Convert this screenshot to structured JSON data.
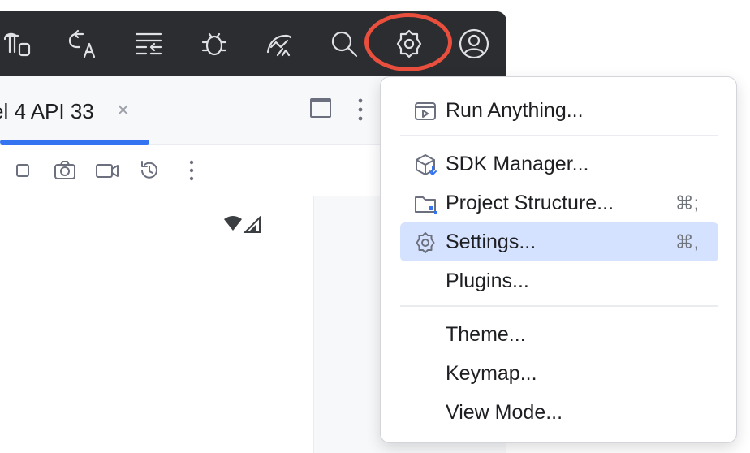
{
  "device_tab": {
    "label": "el 4 API 33",
    "close": "×"
  },
  "toolbar_icons": [
    "build-icon",
    "translate-icon",
    "format-icon",
    "debug-icon",
    "profiler-icon",
    "search-icon",
    "gear-icon",
    "account-icon"
  ],
  "emulator_toolbar_icons": [
    "stop-icon",
    "camera-icon",
    "video-icon",
    "rotate-icon",
    "more-icon"
  ],
  "highlight_color": "#ea4f3d",
  "accent_color": "#3574f0",
  "menu": {
    "items": [
      {
        "label": "Run Anything...",
        "shortcut": "",
        "icon": "run-anything-icon"
      },
      {
        "label": "SDK Manager...",
        "shortcut": "",
        "icon": "sdk-manager-icon"
      },
      {
        "label": "Project Structure...",
        "shortcut": "⌘;",
        "icon": "project-structure-icon"
      },
      {
        "label": "Settings...",
        "shortcut": "⌘,",
        "icon": "settings-gear-icon",
        "selected": true
      },
      {
        "label": "Plugins...",
        "shortcut": ""
      },
      {
        "label": "Theme...",
        "shortcut": ""
      },
      {
        "label": "Keymap...",
        "shortcut": ""
      },
      {
        "label": "View Mode...",
        "shortcut": ""
      }
    ]
  }
}
